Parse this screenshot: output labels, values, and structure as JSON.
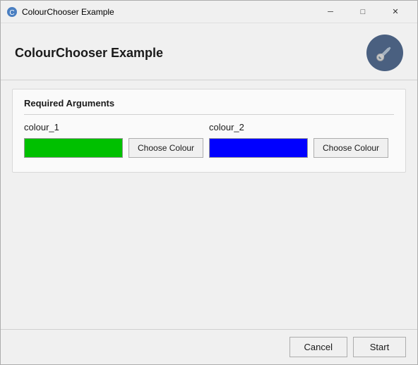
{
  "titleBar": {
    "title": "ColourChooser Example",
    "minimize": "─",
    "maximize": "□",
    "close": "✕"
  },
  "header": {
    "appTitle": "ColourChooser Example",
    "iconLabel": "wrench-icon"
  },
  "section": {
    "title": "Required Arguments",
    "arg1": {
      "label": "colour_1",
      "colour": "#00c000",
      "buttonLabel": "Choose Colour"
    },
    "arg2": {
      "label": "colour_2",
      "colour": "#0000ff",
      "buttonLabel": "Choose Colour"
    }
  },
  "footer": {
    "cancelLabel": "Cancel",
    "startLabel": "Start"
  }
}
